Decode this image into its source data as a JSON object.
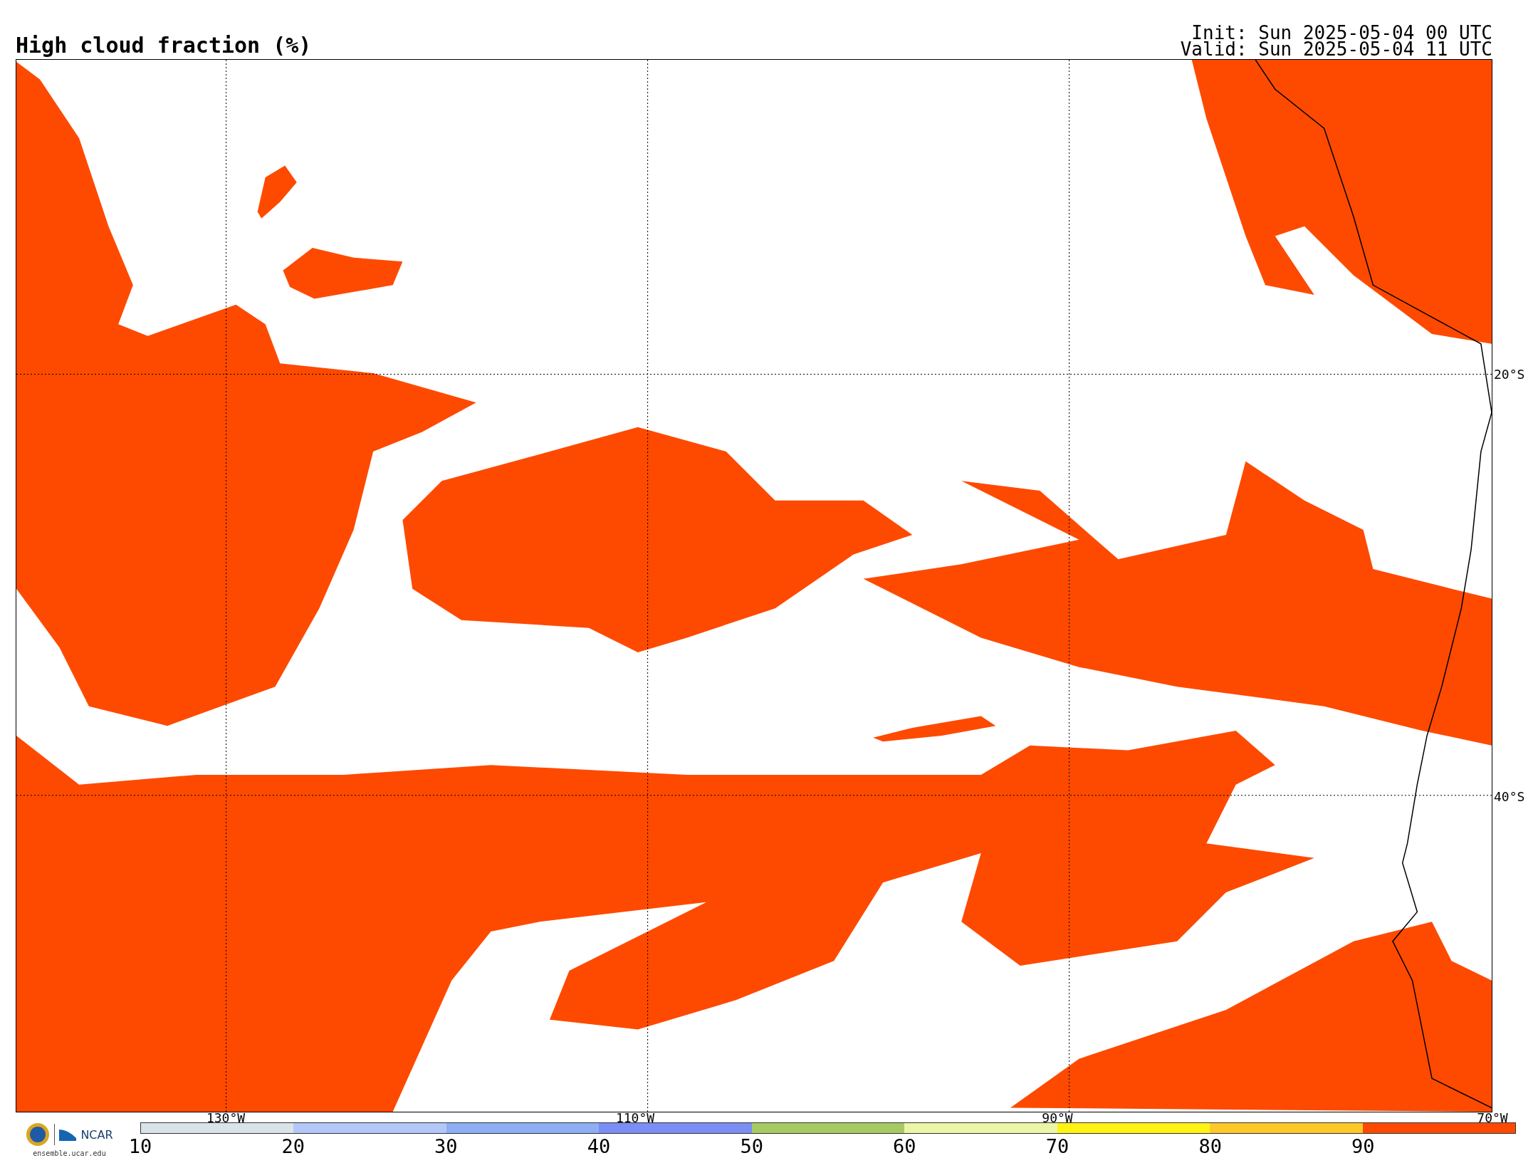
{
  "title": "High cloud fraction (%)",
  "init": "Init: Sun 2025-05-04 00 UTC",
  "valid": "Valid: Sun 2025-05-04 11 UTC",
  "map": {
    "lat_labels": [
      "20°S",
      "40°S"
    ],
    "lon_labels": [
      "130°W",
      "110°W",
      "90°W",
      "70°W"
    ]
  },
  "logo": {
    "name": "NCAR",
    "url": "ensemble.ucar.edu"
  },
  "colorbar": [
    {
      "label": "10",
      "color": "#d9e4ea"
    },
    {
      "label": "20",
      "color": "#b3c8f8"
    },
    {
      "label": "30",
      "color": "#8eaef6"
    },
    {
      "label": "40",
      "color": "#7b8ef4"
    },
    {
      "label": "50",
      "color": "#a6cb63"
    },
    {
      "label": "60",
      "color": "#ebf6a6"
    },
    {
      "label": "70",
      "color": "#fff314"
    },
    {
      "label": "80",
      "color": "#fcc928"
    },
    {
      "label": "90",
      "color": "#fe4a00"
    }
  ]
}
